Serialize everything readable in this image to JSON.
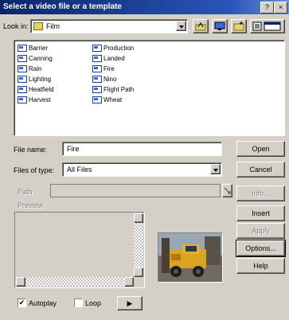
{
  "window": {
    "title": "Select a video file or a template",
    "help_label": "?",
    "close_label": "×"
  },
  "look_in": {
    "label": "Look in:",
    "value": "Film"
  },
  "files": [
    {
      "name": "Barrier"
    },
    {
      "name": "Canning"
    },
    {
      "name": "Rain"
    },
    {
      "name": "Lighting"
    },
    {
      "name": "Heatfield"
    },
    {
      "name": "Harvest"
    },
    {
      "name": "Production"
    },
    {
      "name": "Landed"
    },
    {
      "name": "Fire"
    },
    {
      "name": "Nino"
    },
    {
      "name": "Flight Path"
    },
    {
      "name": "Wheat"
    }
  ],
  "file_name": {
    "label": "File name:",
    "value": "Fire"
  },
  "files_of_type": {
    "label": "Files of type:",
    "value": "All Files"
  },
  "path": {
    "label": "Path",
    "value": ""
  },
  "preview_label": "Preview",
  "buttons": {
    "open": "Open",
    "cancel": "Cancel",
    "info": "Info...",
    "insert": "Insert",
    "apply": "Apply",
    "options": "Options...",
    "help": "Help",
    "play": "▶"
  },
  "checkboxes": {
    "autoplay": "Autoplay",
    "loop": "Loop",
    "autoplay_checked": true,
    "loop_checked": false
  }
}
